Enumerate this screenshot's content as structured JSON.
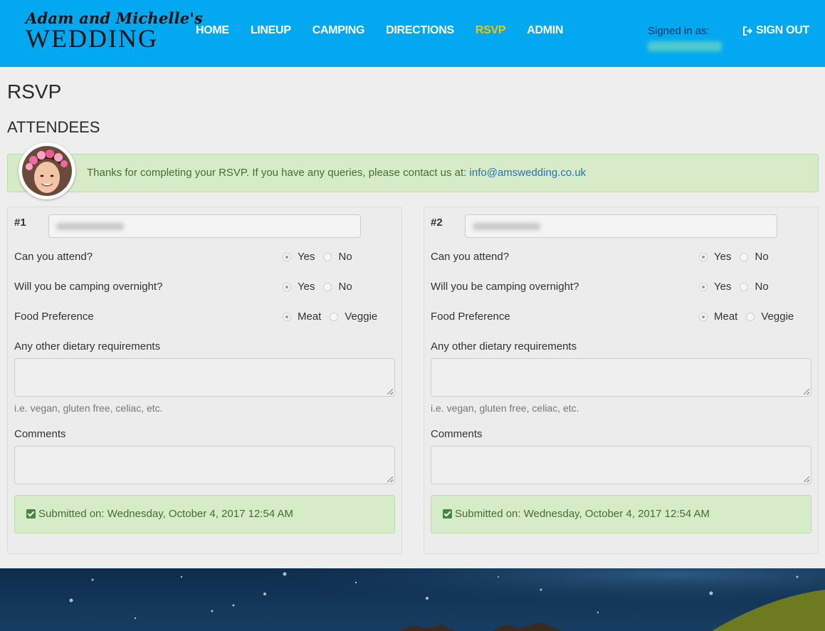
{
  "brand": {
    "line1": "Adam and Michelle's",
    "line2": "WEDDING"
  },
  "nav": {
    "items": [
      {
        "label": "HOME",
        "active": false
      },
      {
        "label": "LINEUP",
        "active": false
      },
      {
        "label": "CAMPING",
        "active": false
      },
      {
        "label": "DIRECTIONS",
        "active": false
      },
      {
        "label": "RSVP",
        "active": true
      },
      {
        "label": "ADMIN",
        "active": false
      }
    ],
    "active_color": "#f5c400"
  },
  "user": {
    "signed_in_label": "Signed in as:",
    "signout_label": "SIGN OUT",
    "signout_icon": "sign-out-icon"
  },
  "page": {
    "title": "RSVP",
    "section": "ATTENDEES"
  },
  "alert": {
    "text": "Thanks for completing your RSVP. If you have any queries, please contact us at:",
    "email": "info@amswedding.co.uk",
    "avatar_icon": "avatar-flower-crown"
  },
  "attendees": [
    {
      "number": "#1",
      "attend": {
        "question": "Can you attend?",
        "options": [
          "Yes",
          "No"
        ],
        "selected": "Yes"
      },
      "camping": {
        "question": "Will you be camping overnight?",
        "options": [
          "Yes",
          "No"
        ],
        "selected": "Yes"
      },
      "food": {
        "question": "Food Preference",
        "options": [
          "Meat",
          "Veggie"
        ],
        "selected": "Meat"
      },
      "dietary": {
        "label": "Any other dietary requirements",
        "value": "",
        "hint": "i.e. vegan, gluten free, celiac, etc."
      },
      "comments": {
        "label": "Comments",
        "value": ""
      },
      "submitted": "Submitted on: Wednesday, October 4, 2017 12:54 AM"
    },
    {
      "number": "#2",
      "attend": {
        "question": "Can you attend?",
        "options": [
          "Yes",
          "No"
        ],
        "selected": "Yes"
      },
      "camping": {
        "question": "Will you be camping overnight?",
        "options": [
          "Yes",
          "No"
        ],
        "selected": "Yes"
      },
      "food": {
        "question": "Food Preference",
        "options": [
          "Meat",
          "Veggie"
        ],
        "selected": "Meat"
      },
      "dietary": {
        "label": "Any other dietary requirements",
        "value": "",
        "hint": "i.e. vegan, gluten free, celiac, etc."
      },
      "comments": {
        "label": "Comments",
        "value": ""
      },
      "submitted": "Submitted on: Wednesday, October 4, 2017 12:54 AM"
    }
  ],
  "colors": {
    "header": "#03a9f0",
    "alert_bg": "#d6ecc8",
    "footer": "#0e2d4b"
  }
}
